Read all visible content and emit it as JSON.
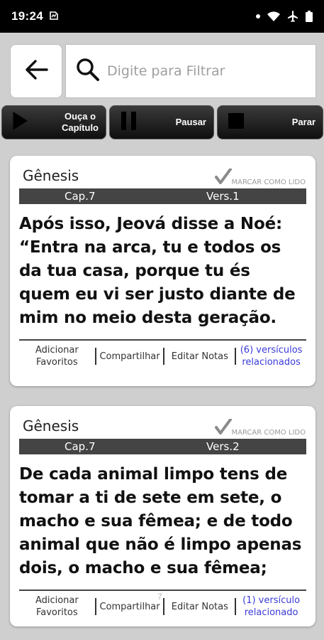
{
  "status_bar": {
    "time": "19:24"
  },
  "header": {
    "search_placeholder": "Digite para Filtrar"
  },
  "audio_controls": {
    "play_label_line1": "Ouça o",
    "play_label_line2": "Capítulo",
    "pause_label": "Pausar",
    "stop_label": "Parar"
  },
  "verses": [
    {
      "book": "Gênesis",
      "mark_read": "MARCAR COMO LIDO",
      "chapter": "Cap.7",
      "verse": "Vers.1",
      "text": "Após isso, Jeová disse a Noé: “Entra na arca, tu e todos os da tua casa, porque tu és quem eu vi ser justo diante de mim no meio desta geração.",
      "fav_line1": "Adicionar",
      "fav_line2": "Favoritos",
      "share": "Compartilhar",
      "notes": "Editar Notas",
      "related_line1": "(6) versículos",
      "related_line2": "relacionados"
    },
    {
      "book": "Gênesis",
      "mark_read": "MARCAR COMO LIDO",
      "chapter": "Cap.7",
      "verse": "Vers.2",
      "text": "De cada animal limpo tens de tomar a ti de sete em sete, o macho e sua fêmea; e de todo animal que não é limpo apenas dois, o macho e sua fêmea;",
      "fav_line1": "Adicionar",
      "fav_line2": "Favoritos",
      "share": "Compartilhar",
      "notes": "Editar Notas",
      "related_line1": "(1) versículo",
      "related_line2": "relacionado"
    }
  ],
  "page_indicator": "7",
  "colors": {
    "ref_bar": "#444444",
    "related_link": "#3a3ad8",
    "audio_button": "#1a1a1a"
  }
}
